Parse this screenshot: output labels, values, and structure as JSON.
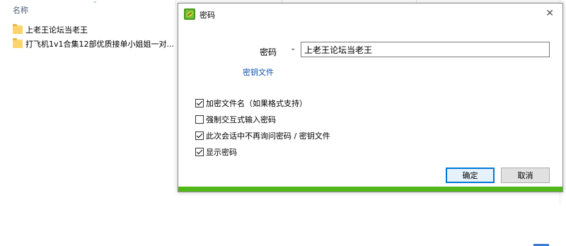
{
  "explorer": {
    "column_name": "名称",
    "sort_arrow": "⌄",
    "files": [
      {
        "name": "上老王论坛当老王",
        "type": "folder"
      },
      {
        "name": "打飞机1v1合集12部优质接单小姐姐一对...",
        "type": "folder"
      }
    ]
  },
  "dialog": {
    "title": "密码",
    "close_glyph": "✕",
    "password_label": "密码",
    "dropdown_glyph": "⌄",
    "password_value": "上老王论坛当老王",
    "keyfile_link": "密钥文件",
    "options": [
      {
        "label": "加密文件名（如果格式支持）",
        "checked": true
      },
      {
        "label": "强制交互式输入密码",
        "checked": false
      },
      {
        "label": "此次会话中不再询问密码 / 密钥文件",
        "checked": true
      },
      {
        "label": "显示密码",
        "checked": true
      }
    ],
    "ok_label": "确定",
    "cancel_label": "取消",
    "progress": 1.0,
    "progress_color": "#51b81a"
  }
}
